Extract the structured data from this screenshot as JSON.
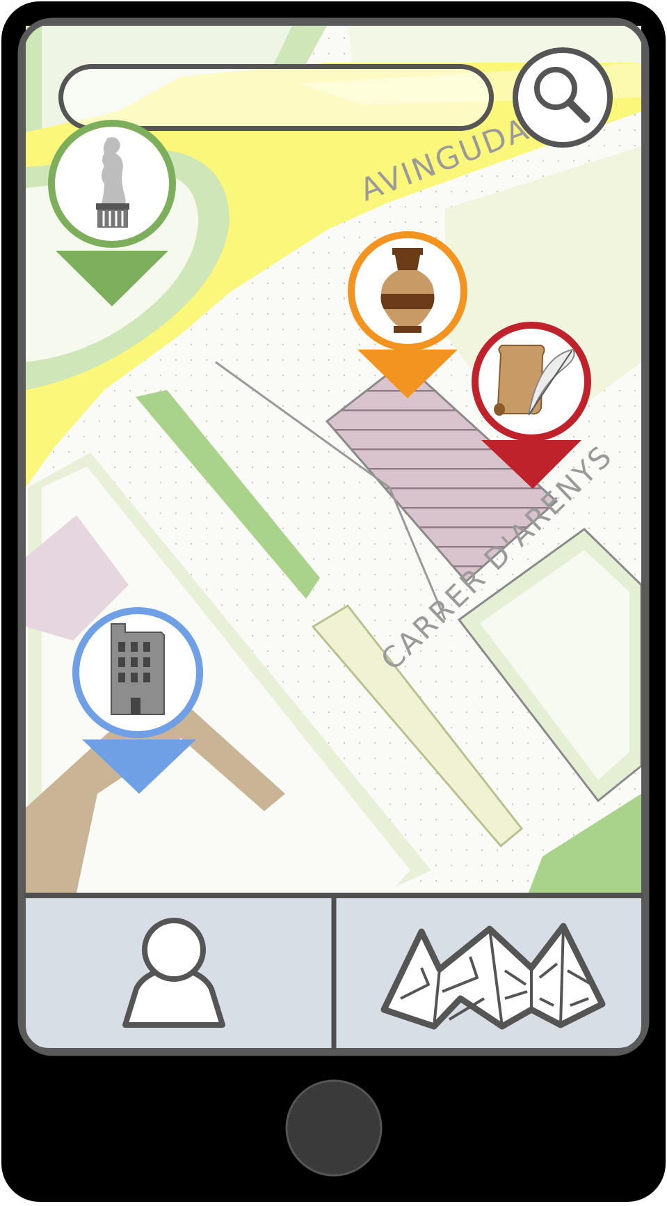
{
  "search": {
    "placeholder": ""
  },
  "map": {
    "streets": [
      "AVINGUDA DE'",
      "CARRER D'ARENYS"
    ]
  },
  "markers": [
    {
      "category": "statue",
      "icon": "statue-icon",
      "color": "#7cae5b"
    },
    {
      "category": "archaeology",
      "icon": "amphora-icon",
      "color": "#f39420"
    },
    {
      "category": "documents",
      "icon": "scroll-quill-icon",
      "color": "#c0222c"
    },
    {
      "category": "building",
      "icon": "building-icon",
      "color": "#6fa0e6"
    }
  ],
  "bottom_nav": [
    {
      "id": "profile",
      "icon": "user-icon"
    },
    {
      "id": "map",
      "icon": "folded-map-icon"
    }
  ],
  "theme": {
    "frame": "#000000",
    "bezel": "#5a5a5a",
    "nav_background": "#d7dee6",
    "road_yellow": "#fbf77a",
    "park_green": "#a9d28b",
    "home_button": "#3a3a3a"
  }
}
